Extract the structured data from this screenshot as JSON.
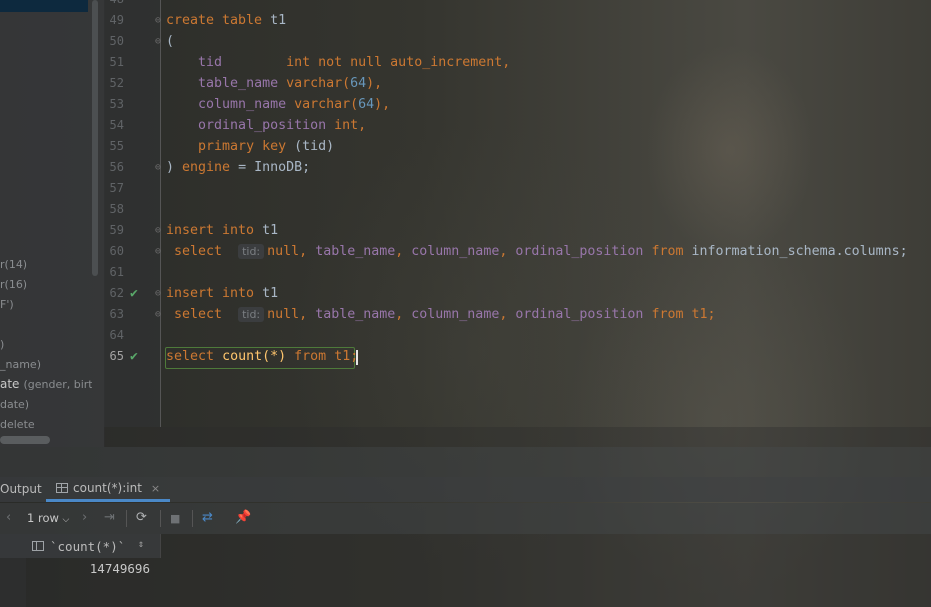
{
  "left_panel": {
    "items": [
      {
        "text": "r(14)"
      },
      {
        "text": "r(16)"
      },
      {
        "text": "F')"
      },
      {
        "text": ")"
      },
      {
        "text": "_name)"
      },
      {
        "text": "ate",
        "extra": "(gender, birt"
      },
      {
        "text": "date)"
      },
      {
        "text": "delete"
      }
    ]
  },
  "editor": {
    "line_numbers": [
      "49",
      "50",
      "51",
      "52",
      "53",
      "54",
      "55",
      "56",
      "57",
      "58",
      "59",
      "60",
      "61",
      "62",
      "63",
      "64",
      "65"
    ],
    "hint_label": "tid:",
    "code": {
      "l49": [
        "create table",
        "t1"
      ],
      "l50": "(",
      "l51": [
        "tid",
        "int not null auto_increment,"
      ],
      "l52": [
        "table_name",
        "varchar(",
        "64",
        "),"
      ],
      "l53": [
        "column_name",
        "varchar(",
        "64",
        "),"
      ],
      "l54": [
        "ordinal_position",
        "int,"
      ],
      "l55": [
        "primary key",
        "(tid)"
      ],
      "l56": [
        ")",
        "engine",
        "= InnoDB;"
      ],
      "l59": [
        "insert into",
        "t1"
      ],
      "l60": [
        "select",
        "null,",
        "table_name",
        "column_name",
        "ordinal_position",
        "from",
        "information_schema.columns;"
      ],
      "l62": [
        "insert into",
        "t1"
      ],
      "l63": [
        "select",
        "null,",
        "table_name",
        "column_name",
        "ordinal_position",
        "from",
        "t1;"
      ],
      "l65": [
        "select",
        "count(",
        "*",
        ")",
        "from",
        "t1;"
      ]
    },
    "colors": {
      "keyword": "#cc7832",
      "column": "#9876aa",
      "number": "#6897bb",
      "text": "#a9b7c6",
      "ok_check": "#59a869"
    }
  },
  "services": {
    "tab_output": "Output",
    "tab_result": "count(*):int",
    "close_glyph": "×",
    "rows_selector": "1 row",
    "icons": [
      "prev-icon",
      "dropdown-chevron-icon",
      "next-icon",
      "last-icon",
      "refresh-icon",
      "stop-icon",
      "compare-icon",
      "pin-icon"
    ]
  },
  "result": {
    "column_header": "`count(*)`",
    "sort_glyph": "⇕",
    "rows": [
      [
        "14749696"
      ]
    ]
  }
}
